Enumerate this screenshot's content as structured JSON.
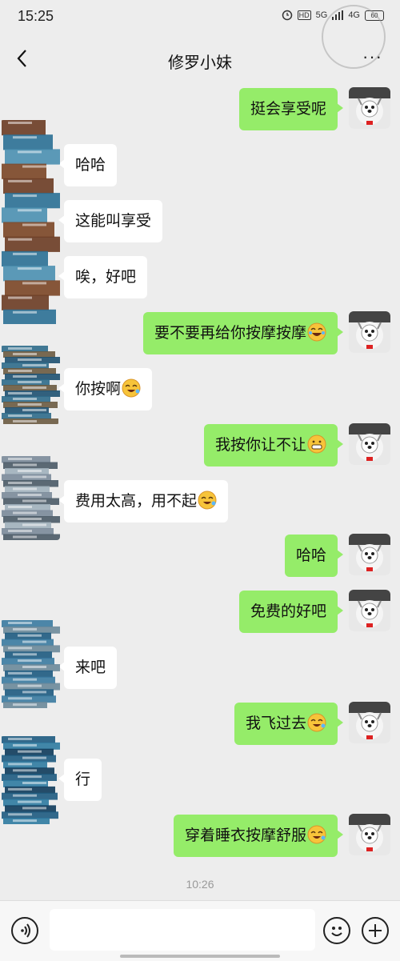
{
  "status": {
    "time": "15:25",
    "network": "5G",
    "network2": "4G",
    "battery": "60"
  },
  "nav": {
    "title": "修罗小妹",
    "more": "···"
  },
  "messages": [
    {
      "side": "me",
      "text": "挺会享受呢",
      "emoji": ""
    },
    {
      "side": "them",
      "text": "哈哈",
      "emoji": ""
    },
    {
      "side": "them",
      "text": "这能叫享受",
      "emoji": ""
    },
    {
      "side": "them",
      "text": "唉，好吧",
      "emoji": ""
    },
    {
      "side": "me",
      "text": "要不要再给你按摩按摩",
      "emoji": "joy"
    },
    {
      "side": "them",
      "text": "你按啊",
      "emoji": "rofl"
    },
    {
      "side": "me",
      "text": "我按你让不让",
      "emoji": "grin"
    },
    {
      "side": "them",
      "text": "费用太高，用不起",
      "emoji": "rofl"
    },
    {
      "side": "me",
      "text": "哈哈",
      "emoji": ""
    },
    {
      "side": "me",
      "text": "免费的好吧",
      "emoji": ""
    },
    {
      "side": "them",
      "text": "来吧",
      "emoji": ""
    },
    {
      "side": "me",
      "text": "我飞过去",
      "emoji": "rofl"
    },
    {
      "side": "them",
      "text": "行",
      "emoji": ""
    },
    {
      "side": "me",
      "text": "穿着睡衣按摩舒服",
      "emoji": "rofl"
    }
  ],
  "timestamp": "10:26",
  "input": {
    "value": "",
    "placeholder": ""
  },
  "colors": {
    "me_bubble": "#95ec69",
    "them_bubble": "#ffffff",
    "background": "#ededed"
  },
  "icons": {
    "back": "chevron-left-icon",
    "more": "more-dots-icon",
    "voice": "voice-icon",
    "emoji": "emoji-icon",
    "plus": "plus-icon"
  }
}
